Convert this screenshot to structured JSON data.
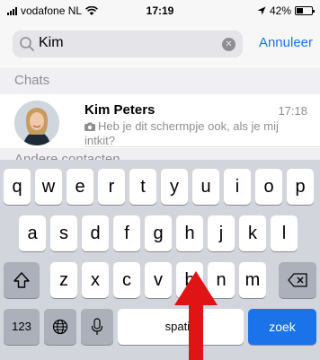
{
  "status_bar": {
    "carrier": "vodafone NL",
    "time": "17:19",
    "battery": "42%"
  },
  "search": {
    "query": "Kim",
    "cancel_label": "Annuleer"
  },
  "sections": {
    "chats": "Chats",
    "contacts": "Andere contacten"
  },
  "chat": {
    "name": "Kim Peters",
    "time": "17:18",
    "preview": "Heb je dit schermpje ook, als je mij intkit?"
  },
  "keyboard": {
    "row1": [
      "q",
      "w",
      "e",
      "r",
      "t",
      "y",
      "u",
      "i",
      "o",
      "p"
    ],
    "row2": [
      "a",
      "s",
      "d",
      "f",
      "g",
      "h",
      "j",
      "k",
      "l"
    ],
    "row3": [
      "z",
      "x",
      "c",
      "v",
      "b",
      "n",
      "m"
    ],
    "numbers_label": "123",
    "space_label": "spatie",
    "go_label": "zoek"
  },
  "colors": {
    "accent": "#1a73e8",
    "arrow": "#e01414"
  }
}
